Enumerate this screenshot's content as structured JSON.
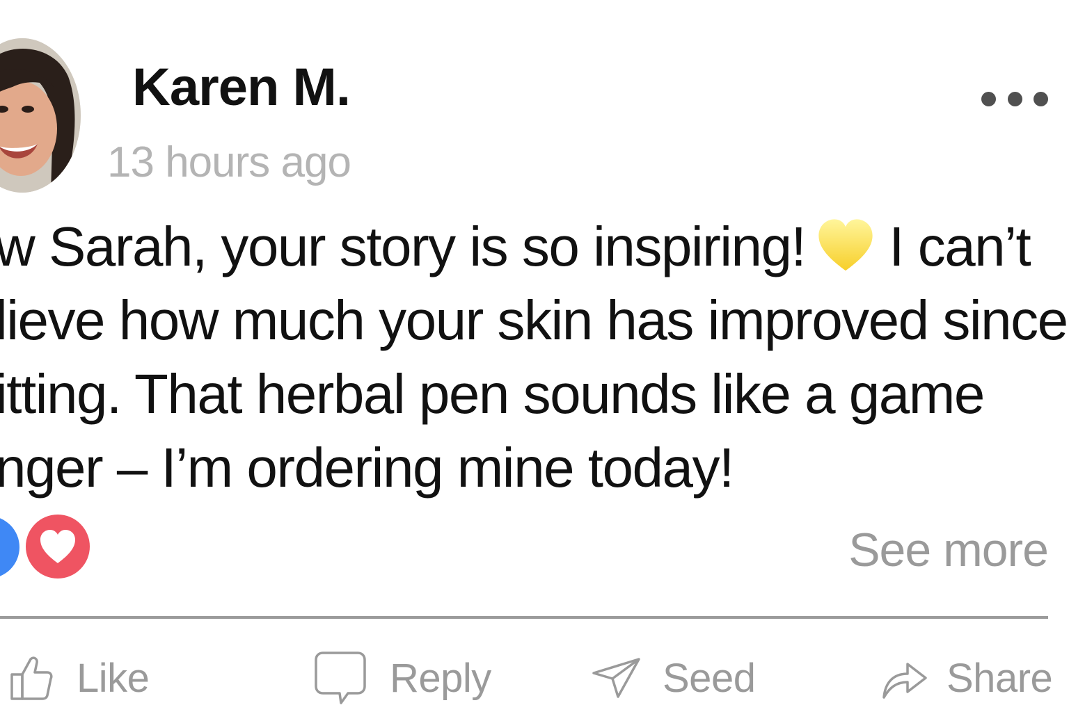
{
  "comment": {
    "author": "Karen M.",
    "timestamp": "13 hours ago",
    "lines": [
      "ow Sarah, your story  is so inspiring!",
      "I can’t",
      "elieve how much your skin has improved since",
      "uitting. That herbal pen sounds like a game",
      "anger – I’m ordering mine today!"
    ],
    "inline_emoji": "yellow-heart-emoji"
  },
  "reactions": [
    "like-reaction-icon",
    "love-reaction-icon"
  ],
  "see_more": "See more",
  "actions": {
    "like": "Like",
    "reply": "Reply",
    "seed": "Seed",
    "share": "Share"
  },
  "colors": {
    "like_reaction": "#3f88f5",
    "love_reaction": "#ef5462",
    "muted_text": "#9a9a9a",
    "timestamp_text": "#b4b4b4",
    "divider": "#9b9b9b"
  }
}
